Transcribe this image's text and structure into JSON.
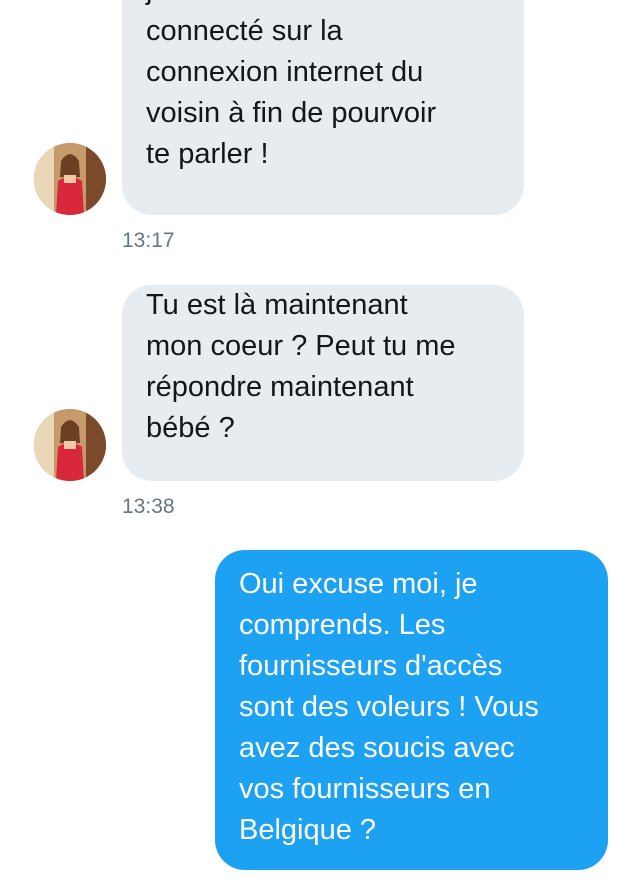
{
  "conversation": {
    "messages": [
      {
        "direction": "incoming",
        "text": "je suie maintenant\nconnecté sur la\nconnexion internet du\nvoisin à fin de pourvoir\nte parler !",
        "time": "13:17",
        "avatar_icon": "profile-photo"
      },
      {
        "direction": "incoming",
        "text": "Tu est là maintenant\nmon coeur ? Peut tu me\nrépondre maintenant\nbébé ?",
        "time": "13:38",
        "avatar_icon": "profile-photo"
      },
      {
        "direction": "outgoing",
        "text": "Oui excuse moi, je\ncomprends. Les\nfournisseurs d'accès\nsont des voleurs ! Vous\navez des soucis avec\nvos fournisseurs en\nBelgique ?"
      }
    ]
  },
  "colors": {
    "incoming_bubble": "#e6ecf0",
    "outgoing_bubble": "#1da1f2",
    "timestamp_text": "#657786"
  }
}
